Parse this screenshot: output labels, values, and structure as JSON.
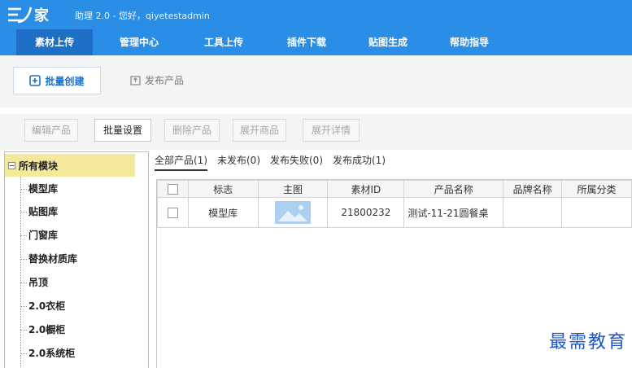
{
  "app": {
    "logo_text": "家",
    "title_info": "助理 2.0 - 您好，qiyetestadmin"
  },
  "nav": {
    "tabs": [
      {
        "label": "素材上传",
        "active": true
      },
      {
        "label": "管理中心"
      },
      {
        "label": "工具上传"
      },
      {
        "label": "插件下载"
      },
      {
        "label": "贴图生成"
      },
      {
        "label": "帮助指导"
      }
    ]
  },
  "toolbar": {
    "batch_create": "批量创建",
    "publish_product": "发布产品"
  },
  "actions": {
    "edit_product": "编辑产品",
    "batch_settings": "批量设置",
    "delete_product": "删除产品",
    "expand_goods": "展开商品",
    "expand_details": "展开详情"
  },
  "tree": {
    "root": "所有模块",
    "items": [
      "模型库",
      "贴图库",
      "门窗库",
      "替换材质库",
      "吊顶",
      "2.0衣柜",
      "2.0橱柜",
      "2.0系统柜"
    ]
  },
  "filters": [
    {
      "label": "全部产品(1)",
      "active": true
    },
    {
      "label": "未发布(0)"
    },
    {
      "label": "发布失败(0)"
    },
    {
      "label": "发布成功(1)"
    }
  ],
  "table": {
    "headers": [
      "",
      "标志",
      "主图",
      "素材ID",
      "产品名称",
      "品牌名称",
      "所属分类"
    ],
    "rows": [
      {
        "flag": "模型库",
        "material_id": "21800232",
        "product_name": "测试-11-21圆餐桌",
        "brand": "",
        "category": ""
      }
    ]
  },
  "watermark": "最需教育",
  "colors": {
    "header_bg": "#2b8ee6",
    "active_tab": "#1f6fc6",
    "tree_highlight": "#f4e89a"
  }
}
